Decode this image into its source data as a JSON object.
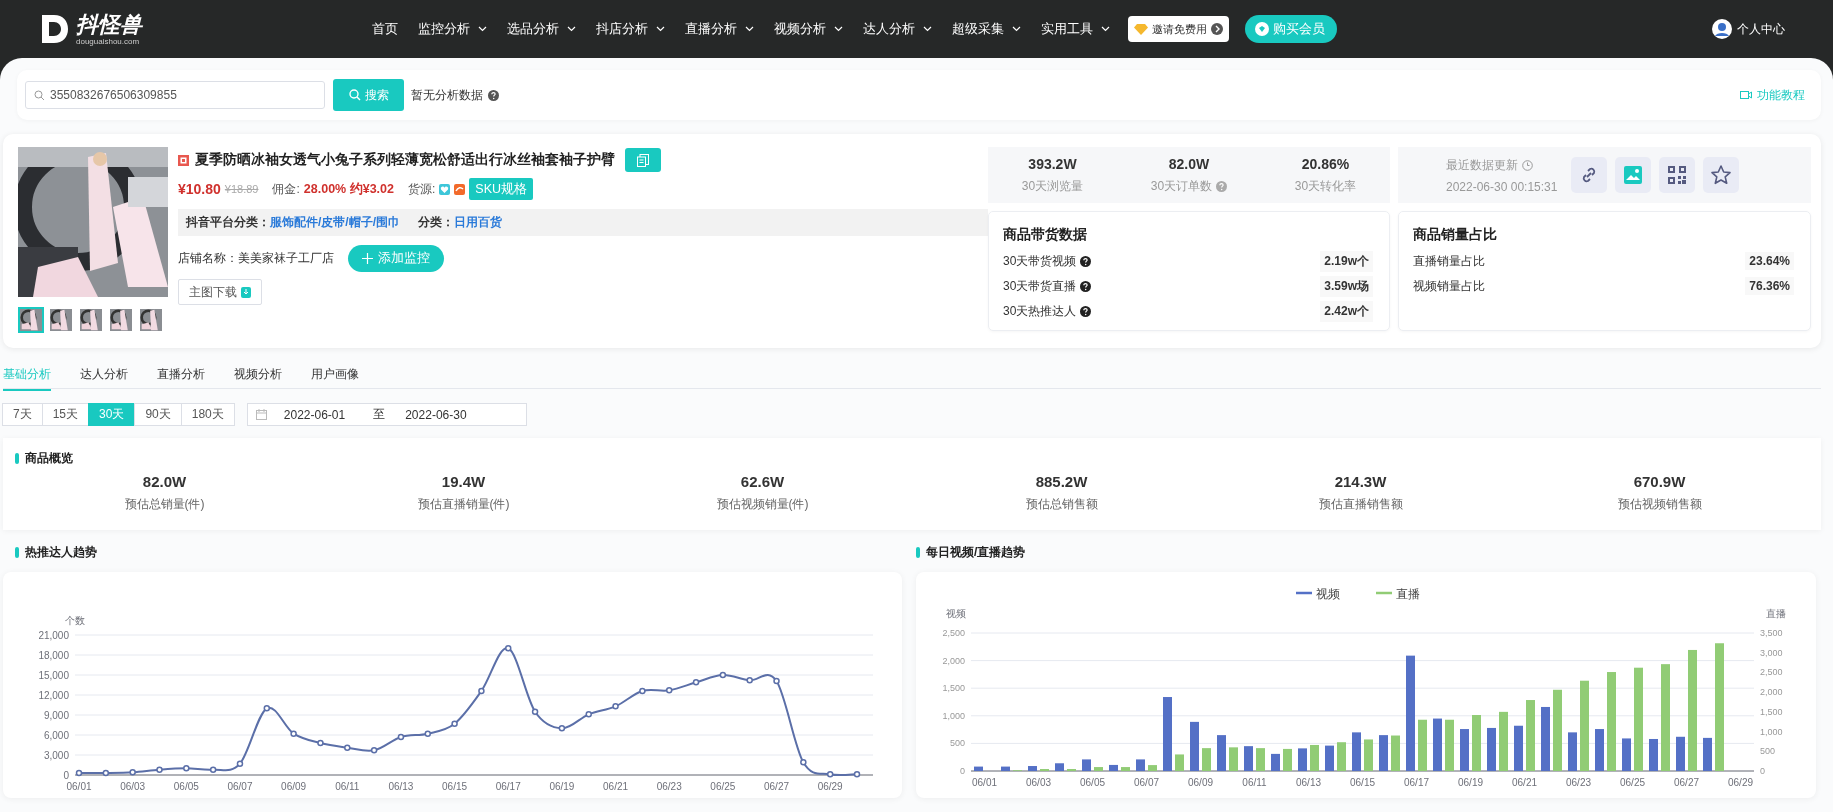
{
  "nav": {
    "logo_text": "抖怪兽",
    "logo_domain": "douguaishou.com",
    "items": [
      {
        "label": "首页",
        "has_menu": false
      },
      {
        "label": "监控分析",
        "has_menu": true
      },
      {
        "label": "选品分析",
        "has_menu": true
      },
      {
        "label": "抖店分析",
        "has_menu": true
      },
      {
        "label": "直播分析",
        "has_menu": true
      },
      {
        "label": "视频分析",
        "has_menu": true
      },
      {
        "label": "达人分析",
        "has_menu": true
      },
      {
        "label": "超级采集",
        "has_menu": true
      },
      {
        "label": "实用工具",
        "has_menu": true
      }
    ],
    "invite_button": "邀请免费用",
    "buy_button": "购买会员",
    "user": "个人中心"
  },
  "search": {
    "value": "3550832676506309855",
    "button": "搜索",
    "note": "暂无分析数据",
    "tutorial": "功能教程"
  },
  "product": {
    "thumbnails": [
      {
        "selected": true
      },
      {
        "selected": false
      },
      {
        "selected": false
      },
      {
        "selected": false
      },
      {
        "selected": false
      }
    ],
    "title": "夏季防晒冰袖女透气小兔子系列轻薄宽松舒适出行冰丝袖套袖子护臂",
    "price": "¥10.80",
    "original_price": "¥18.89",
    "commission_label": "佣金:",
    "commission": "28.00% 约¥3.02",
    "source_label": "货源:",
    "sku_button": "SKU规格",
    "category_label": "抖音平台分类：",
    "category": "服饰配件/皮带/帽子/围巾",
    "class_label": "分类：",
    "class": "日用百货",
    "shop": "店铺名称：美美家袜子工厂店",
    "monitor_button": "添加监控",
    "download_button": "主图下载"
  },
  "stats": [
    {
      "value": "393.2W",
      "label": "30天浏览量",
      "help": false
    },
    {
      "value": "82.0W",
      "label": "30天订单数",
      "help": true
    },
    {
      "value": "20.86%",
      "label": "30天转化率",
      "help": false
    }
  ],
  "update": {
    "label": "最近数据更新",
    "time": "2022-06-30 00:15:31"
  },
  "sales_data": {
    "title": "商品带货数据",
    "rows": [
      {
        "label": "30天带货视频",
        "value": "2.19w个",
        "help": true
      },
      {
        "label": "30天带货直播",
        "value": "3.59w场",
        "help": true
      },
      {
        "label": "30天热推达人",
        "value": "2.42w个",
        "help": true
      }
    ]
  },
  "sales_share": {
    "title": "商品销量占比",
    "rows": [
      {
        "label": "直播销量占比",
        "value": "23.64%",
        "help": false
      },
      {
        "label": "视频销量占比",
        "value": "76.36%",
        "help": false
      }
    ]
  },
  "tabs": [
    {
      "label": "基础分析",
      "selected": true
    },
    {
      "label": "达人分析",
      "selected": false
    },
    {
      "label": "直播分析",
      "selected": false
    },
    {
      "label": "视频分析",
      "selected": false
    },
    {
      "label": "用户画像",
      "selected": false
    }
  ],
  "ranges": [
    {
      "label": "7天",
      "selected": false
    },
    {
      "label": "15天",
      "selected": false
    },
    {
      "label": "30天",
      "selected": true
    },
    {
      "label": "90天",
      "selected": false
    },
    {
      "label": "180天",
      "selected": false
    }
  ],
  "date_range": {
    "start": "2022-06-01",
    "separator": "至",
    "end": "2022-06-30"
  },
  "overview": {
    "title": "商品概览",
    "metrics": [
      {
        "value": "82.0W",
        "label": "预估总销量(件)"
      },
      {
        "value": "19.4W",
        "label": "预估直播销量(件)"
      },
      {
        "value": "62.6W",
        "label": "预估视频销量(件)"
      },
      {
        "value": "885.2W",
        "label": "预估总销售额"
      },
      {
        "value": "214.3W",
        "label": "预估直播销售额"
      },
      {
        "value": "670.9W",
        "label": "预估视频销售额"
      }
    ]
  },
  "talent_trend": {
    "title": "热推达人趋势",
    "chart_data": {
      "type": "line",
      "ylabel": "个数",
      "grid": true,
      "ylim": [
        0,
        21000
      ],
      "yticks": [
        0,
        {
          "value": 3000,
          "label": "3,000"
        },
        {
          "value": 6000,
          "label": "6,000"
        },
        {
          "value": 9000,
          "label": "9,000"
        },
        {
          "value": 12000,
          "label": "12,000"
        },
        {
          "value": 15000,
          "label": "15,000"
        },
        {
          "value": 18000,
          "label": "18,000"
        },
        {
          "value": 21000,
          "label": "21,000"
        }
      ],
      "categories": [
        "06/01",
        null,
        "06/03",
        null,
        "06/05",
        null,
        "06/07",
        null,
        "06/09",
        null,
        "06/11",
        null,
        "06/13",
        null,
        "06/15",
        null,
        "06/17",
        null,
        "06/19",
        null,
        "06/21",
        null,
        "06/23",
        null,
        "06/25",
        null,
        "06/27",
        null,
        "06/29",
        null
      ],
      "series": [
        {
          "color": "#5b6fa8",
          "marker": true,
          "values": [
            300,
            300,
            400,
            800,
            1000,
            800,
            1700,
            10000,
            6200,
            4800,
            4100,
            3700,
            5700,
            6200,
            7700,
            12600,
            19000,
            9500,
            7000,
            9100,
            10300,
            12600,
            12700,
            13900,
            15000,
            14200,
            14100,
            1900,
            100,
            100
          ]
        }
      ]
    }
  },
  "daily_trend": {
    "title": "每日视频/直播趋势",
    "chart_data": {
      "type": "bar",
      "grid": true,
      "ylabel": "视频",
      "y2label": "直播",
      "ylim": [
        0,
        2500
      ],
      "y2lim": [
        0,
        3500
      ],
      "yticks": [
        0,
        500,
        {
          "value": 1000,
          "label": "1,000"
        },
        {
          "value": 1500,
          "label": "1,500"
        },
        {
          "value": 2000,
          "label": "2,000"
        },
        {
          "value": 2500,
          "label": "2,500"
        }
      ],
      "y2ticks": [
        0,
        500,
        {
          "value": 1000,
          "label": "1,000"
        },
        {
          "value": 1500,
          "label": "1,500"
        },
        {
          "value": 2000,
          "label": "2,000"
        },
        {
          "value": 2500,
          "label": "2,500"
        },
        {
          "value": 3000,
          "label": "3,000"
        },
        {
          "value": 3500,
          "label": "3,500"
        }
      ],
      "legend": true,
      "categories": [
        "06/01",
        null,
        "06/03",
        null,
        "06/05",
        null,
        "06/07",
        null,
        "06/09",
        null,
        "06/11",
        null,
        "06/13",
        null,
        "06/15",
        null,
        "06/17",
        null,
        "06/19",
        null,
        "06/21",
        null,
        "06/23",
        null,
        "06/25",
        null,
        "06/27",
        null,
        "06/29"
      ],
      "series": [
        {
          "name": "视频",
          "color": "#5470c6",
          "values": [
            80,
            80,
            90,
            140,
            210,
            110,
            210,
            1340,
            890,
            650,
            450,
            310,
            410,
            460,
            700,
            650,
            2090,
            950,
            760,
            780,
            820,
            1160,
            700,
            760,
            590,
            580,
            620,
            600,
            null
          ]
        },
        {
          "name": "直播",
          "color": "#91cc75",
          "axis": "y2",
          "values": [
            null,
            20,
            50,
            50,
            100,
            100,
            150,
            420,
            580,
            600,
            580,
            560,
            660,
            730,
            800,
            900,
            1300,
            1300,
            1420,
            1500,
            1800,
            2060,
            2290,
            2510,
            2620,
            2710,
            3070,
            3240,
            null
          ]
        }
      ]
    }
  }
}
